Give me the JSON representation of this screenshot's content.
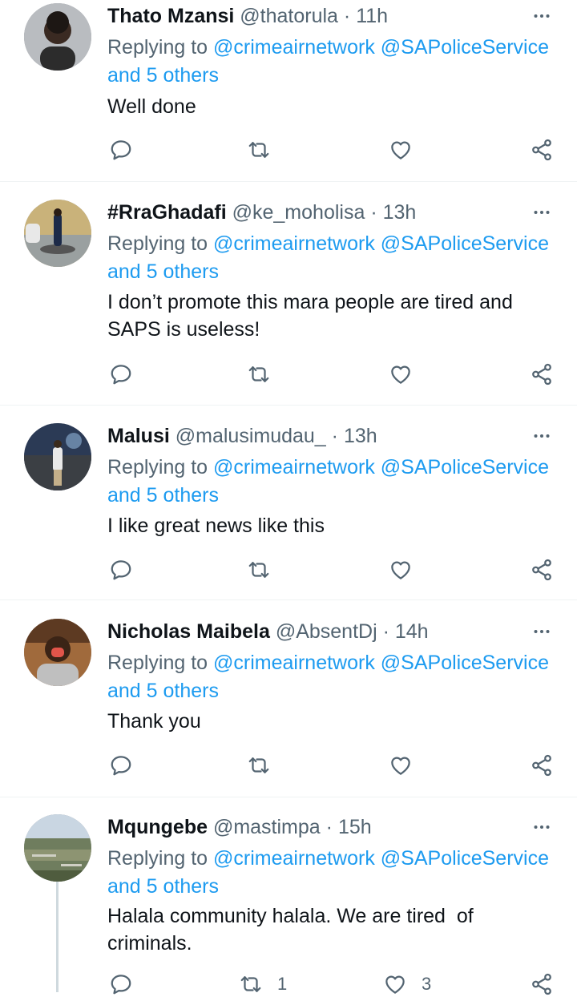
{
  "tweets": [
    {
      "name": "Thato Mzansi",
      "handle": "@thatorula",
      "dot": "·",
      "time": "11h",
      "replying_prefix": "Replying to ",
      "mention1": "@crimeairnetwork",
      "mention2": "@SAPoliceService",
      "others": "and 5 others",
      "text": "Well done",
      "retweets": "",
      "likes": ""
    },
    {
      "name": "#RraGhadafi",
      "handle": "@ke_moholisa",
      "dot": "·",
      "time": "13h",
      "replying_prefix": "Replying to ",
      "mention1": "@crimeairnetwork",
      "mention2": "@SAPoliceService",
      "others": "and 5 others",
      "text": "I don’t promote this mara people are tired and\nSAPS is useless!",
      "retweets": "",
      "likes": ""
    },
    {
      "name": "Malusi",
      "handle": "@malusimudau_",
      "dot": "·",
      "time": "13h",
      "replying_prefix": "Replying to ",
      "mention1": "@crimeairnetwork",
      "mention2": "@SAPoliceService",
      "others": "and 5 others",
      "text": "I like great news like this",
      "retweets": "",
      "likes": ""
    },
    {
      "name": "Nicholas Maibela",
      "handle": "@AbsentDj",
      "dot": "·",
      "time": "14h",
      "replying_prefix": "Replying to ",
      "mention1": "@crimeairnetwork",
      "mention2": "@SAPoliceService",
      "others": "and 5 others",
      "text": "Thank you",
      "retweets": "",
      "likes": ""
    },
    {
      "name": "Mqungebe",
      "handle": "@mastimpa",
      "dot": "·",
      "time": "15h",
      "replying_prefix": "Replying to ",
      "mention1": "@crimeairnetwork",
      "mention2": "@SAPoliceService",
      "others": "and 5 others",
      "text": "Halala community halala. We are tired  of\ncriminals.",
      "retweets": "1",
      "likes": "3"
    }
  ],
  "icons": {
    "reply": "reply-icon",
    "retweet": "retweet-icon",
    "like": "heart-icon",
    "share": "share-icon",
    "more": "more-icon"
  },
  "colors": {
    "link": "#1d9bf0",
    "secondary_text": "#536471",
    "primary_text": "#0f1419",
    "divider": "#eff3f4"
  }
}
